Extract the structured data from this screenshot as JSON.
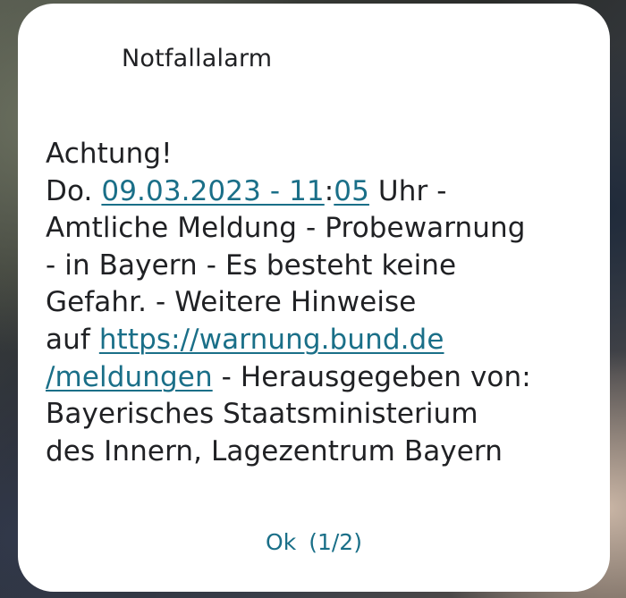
{
  "dialog": {
    "title": "Notfallalarm",
    "body": {
      "heading": "Achtung!",
      "day_prefix": "Do. ",
      "date_link": "09.03.2023 - 11",
      "time_colon": ":",
      "minute_link": "05",
      "after_time": " Uhr -",
      "line3": "Amtliche Meldung - Probewarnung",
      "line4": "- in Bayern - Es besteht keine",
      "line5": "Gefahr. - Weitere Hinweise",
      "auf_prefix": "auf ",
      "url_link_part1": "https://warnung.bund.de",
      "url_link_part2": "/meldungen",
      "after_url": " - Herausgegeben von:",
      "line8": "Bayerisches Staatsministerium",
      "line9": "des Innern, Lagezentrum Bayern"
    },
    "ok_button": {
      "label": "Ok",
      "counter": "(1/2)"
    }
  },
  "colors": {
    "dialog_background": "#ffffff",
    "text": "#202124",
    "accent_link": "#1a6f88"
  }
}
